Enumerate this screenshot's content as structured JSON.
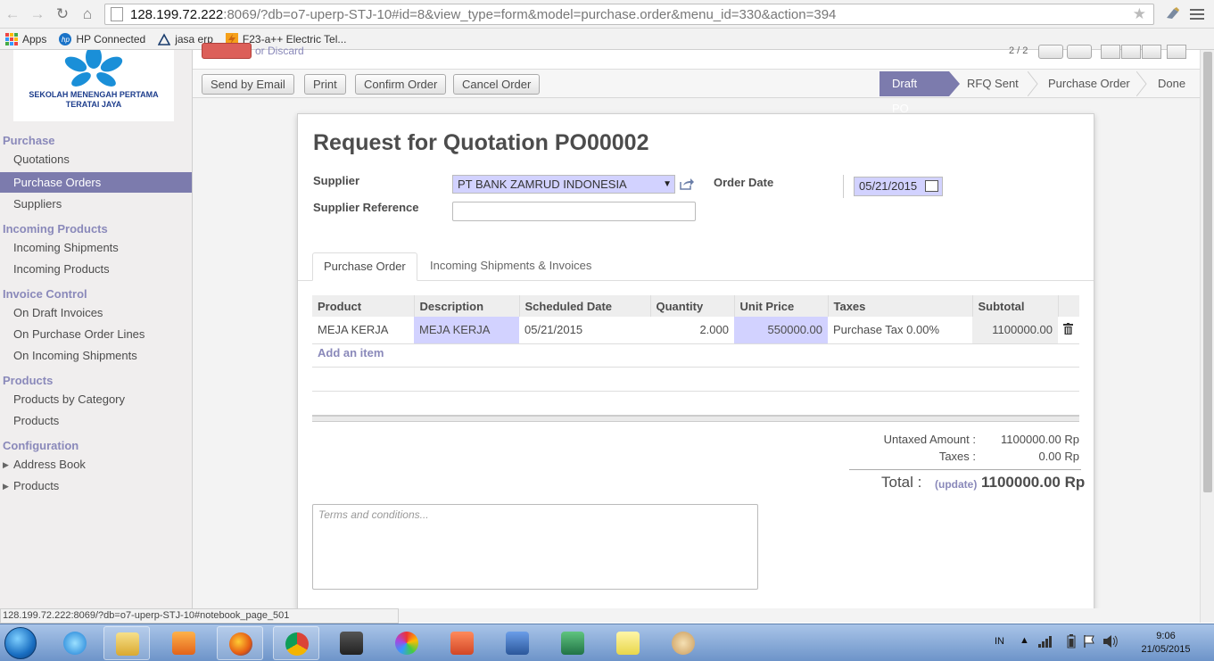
{
  "browser": {
    "url_host": "128.199.72.222",
    "url_rest": ":8069/?db=o7-uperp-STJ-10#id=8&view_type=form&model=purchase.order&menu_id=330&action=394",
    "bookmarks": [
      {
        "label": "Apps",
        "icon": "apps-grid-icon"
      },
      {
        "label": "HP Connected",
        "icon": "hp-logo-icon"
      },
      {
        "label": "jasa erp",
        "icon": "triangle-icon"
      },
      {
        "label": "F23-a++ Electric Tel...",
        "icon": "bolt-icon"
      }
    ],
    "status_url": "128.199.72.222:8069/?db=o7-uperp-STJ-10#notebook_page_501"
  },
  "sidebar": {
    "logo_line1": "SEKOLAH MENENGAH PERTAMA",
    "logo_line2": "TERATAI JAYA",
    "sections": [
      {
        "title": "Purchase",
        "items": [
          "Quotations",
          "Purchase Orders",
          "Suppliers"
        ]
      },
      {
        "title": "Incoming Products",
        "items": [
          "Incoming Shipments",
          "Incoming Products"
        ]
      },
      {
        "title": "Invoice Control",
        "items": [
          "On Draft Invoices",
          "On Purchase Order Lines",
          "On Incoming Shipments"
        ]
      },
      {
        "title": "Products",
        "items": [
          "Products by Category",
          "Products"
        ]
      },
      {
        "title": "Configuration",
        "items": [
          "Address Book",
          "Products"
        ]
      }
    ],
    "active_item": "Purchase Orders"
  },
  "toolbar": {
    "discard_label": "or Discard",
    "pager": "2 / 2",
    "buttons": [
      "Send by Email",
      "Print",
      "Confirm Order",
      "Cancel Order"
    ]
  },
  "statusbar": {
    "stages": [
      "Draft PO",
      "RFQ Sent",
      "Purchase Order",
      "Done"
    ],
    "current": "Draft PO"
  },
  "form": {
    "title_prefix": "Request for Quotation",
    "order_number": "PO00002",
    "supplier_label": "Supplier",
    "supplier_value": "PT BANK ZAMRUD INDONESIA",
    "supplier_ref_label": "Supplier Reference",
    "supplier_ref_value": "",
    "order_date_label": "Order Date",
    "order_date_value": "05/21/2015",
    "tabs": [
      "Purchase Order",
      "Incoming Shipments & Invoices"
    ],
    "active_tab": "Purchase Order",
    "columns": [
      "Product",
      "Description",
      "Scheduled Date",
      "Quantity",
      "Unit Price",
      "Taxes",
      "Subtotal"
    ],
    "lines": [
      {
        "product": "MEJA KERJA",
        "description": "MEJA KERJA",
        "scheduled_date": "05/21/2015",
        "quantity": "2.000",
        "unit_price": "550000.00",
        "taxes": "Purchase Tax 0.00%",
        "subtotal": "1100000.00"
      }
    ],
    "add_item_label": "Add an item",
    "untaxed_label": "Untaxed Amount :",
    "untaxed_value": "1100000.00 Rp",
    "taxes_label": "Taxes :",
    "taxes_value": "0.00 Rp",
    "total_label": "Total :",
    "update_label": "(update)",
    "total_value": "1100000.00 Rp",
    "terms_placeholder": "Terms and conditions..."
  },
  "taskbar": {
    "language": "IN",
    "time": "9:06",
    "date": "21/05/2015"
  },
  "colors": {
    "accent": "#7c7bad",
    "required_field": "#d2d2ff",
    "save_button": "#dc5f59"
  }
}
